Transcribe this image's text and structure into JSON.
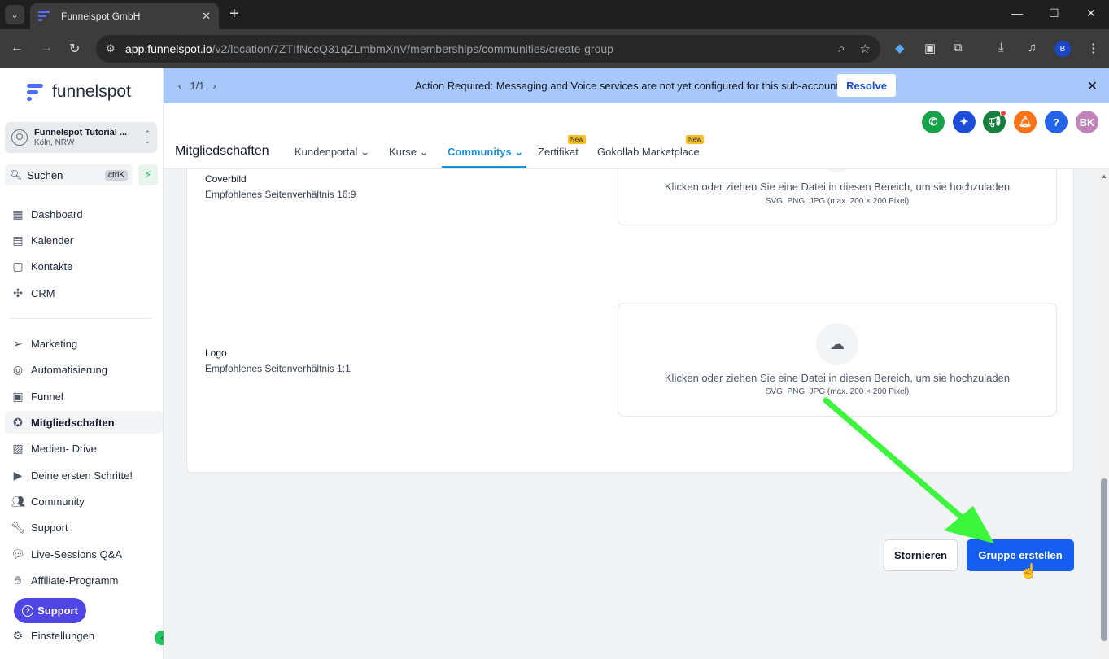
{
  "browser": {
    "tab_title": "Funnelspot GmbH",
    "url_host": "app.funnelspot.io",
    "url_path": "/v2/location/7ZTIfNccQ31qZLmbmXnV/memberships/communities/create-group",
    "profile_initial": "B"
  },
  "sidebar": {
    "brand": "funnelspot",
    "account_name": "Funnelspot Tutorial ...",
    "account_location": "Köln, NRW",
    "search_label": "Suchen",
    "search_shortcut": "ctrlK",
    "items": [
      {
        "label": "Dashboard",
        "icon": "dashboard-icon"
      },
      {
        "label": "Kalender",
        "icon": "calendar-icon"
      },
      {
        "label": "Kontakte",
        "icon": "contacts-icon"
      },
      {
        "label": "CRM",
        "icon": "crm-icon"
      },
      {
        "label": "Marketing",
        "icon": "send-icon"
      },
      {
        "label": "Automatisierung",
        "icon": "automation-icon"
      },
      {
        "label": "Funnel",
        "icon": "funnel-icon"
      },
      {
        "label": "Mitgliedschaften",
        "icon": "award-icon"
      },
      {
        "label": "Medien- Drive",
        "icon": "image-icon"
      },
      {
        "label": "Deine ersten Schritte!",
        "icon": "play-icon"
      },
      {
        "label": "Community",
        "icon": "users-icon"
      },
      {
        "label": "Support",
        "icon": "wrench-icon"
      },
      {
        "label": "Live-Sessions Q&A",
        "icon": "chat-icon"
      },
      {
        "label": "Affiliate-Programm",
        "icon": "hand-coin-icon"
      },
      {
        "label": "Einstellungen",
        "icon": "gear-icon"
      }
    ],
    "support_button": "Support"
  },
  "banner": {
    "pager": "1/1",
    "message": "Action Required: Messaging and Voice services are not yet configured for this sub-account!",
    "resolve_label": "Resolve"
  },
  "header": {
    "title": "Mitgliedschaften",
    "avatar_initials": "BK",
    "help_label": "?",
    "tabs": [
      {
        "label": "Kundenportal"
      },
      {
        "label": "Kurse"
      },
      {
        "label": "Communitys"
      },
      {
        "label": "Zertifikat",
        "badge": "New"
      },
      {
        "label": "Gokollab Marketplace",
        "badge": "New"
      }
    ]
  },
  "form": {
    "cover": {
      "label": "Coverbild",
      "hint": "Empfohlenes Seitenverhältnis 16:9",
      "drop_text": "Klicken oder ziehen Sie eine Datei in diesen Bereich, um sie hochzuladen",
      "formats": "SVG, PNG, JPG (max. 200 × 200 Pixel)"
    },
    "logo": {
      "label": "Logo",
      "hint": "Empfohlenes Seitenverhältnis 1:1",
      "drop_text": "Klicken oder ziehen Sie eine Datei in diesen Bereich, um sie hochzuladen",
      "formats": "SVG, PNG, JPG (max. 200 × 200 Pixel)"
    },
    "cancel_label": "Stornieren",
    "create_label": "Gruppe erstellen"
  },
  "colors": {
    "primary_button": "#155eef",
    "active_tab": "#1d8fd8",
    "banner": "#a8c7fa",
    "annotation_arrow": "#3df53d"
  }
}
